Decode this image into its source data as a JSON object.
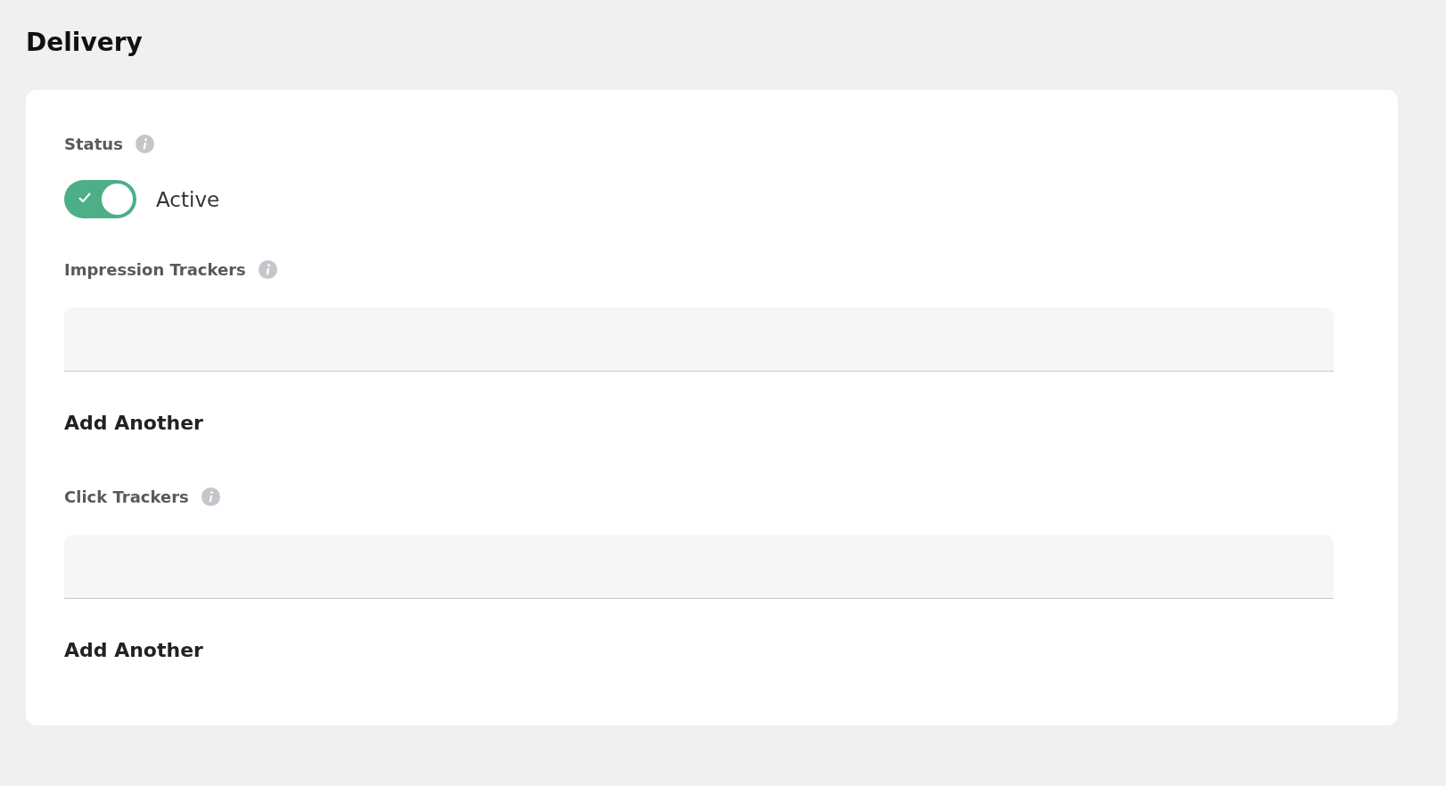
{
  "title": "Delivery",
  "status": {
    "label": "Status",
    "on": true,
    "value": "Active"
  },
  "trackers": [
    {
      "label": "Impression Trackers",
      "add_label": "Add Another"
    },
    {
      "label": "Click Trackers",
      "add_label": "Add Another"
    }
  ]
}
